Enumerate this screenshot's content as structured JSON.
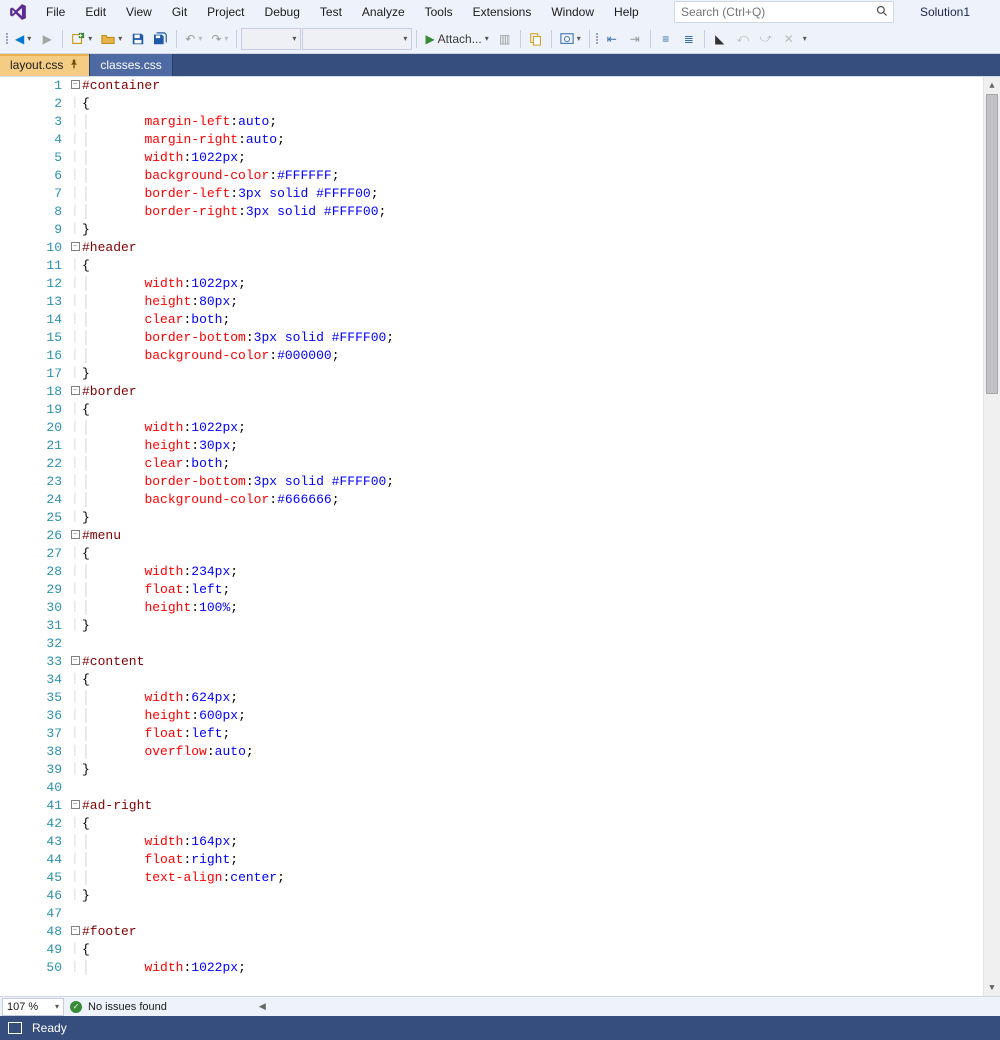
{
  "menu": {
    "items": [
      "File",
      "Edit",
      "View",
      "Git",
      "Project",
      "Debug",
      "Test",
      "Analyze",
      "Tools",
      "Extensions",
      "Window",
      "Help"
    ]
  },
  "search": {
    "placeholder": "Search (Ctrl+Q)"
  },
  "solution": {
    "label": "Solution1"
  },
  "toolbar": {
    "attach_label": "Attach..."
  },
  "tabs": [
    {
      "label": "layout.css",
      "active": true,
      "pinned": true
    },
    {
      "label": "classes.css",
      "active": false,
      "pinned": false
    }
  ],
  "editor": {
    "zoom": "107 %",
    "issues_text": "No issues found"
  },
  "statusbar": {
    "text": "Ready"
  },
  "code": {
    "lines": [
      {
        "n": 1,
        "fold": "box",
        "tokens": [
          [
            "sel",
            "#container"
          ]
        ]
      },
      {
        "n": 2,
        "fold": "pipe",
        "tokens": [
          [
            "punc",
            "{"
          ]
        ]
      },
      {
        "n": 3,
        "fold": "pipe",
        "indent": 2,
        "tokens": [
          [
            "prop",
            "margin-left"
          ],
          [
            "punc",
            ":"
          ],
          [
            "val",
            "auto"
          ],
          [
            "punc",
            ";"
          ]
        ]
      },
      {
        "n": 4,
        "fold": "pipe",
        "indent": 2,
        "tokens": [
          [
            "prop",
            "margin-right"
          ],
          [
            "punc",
            ":"
          ],
          [
            "val",
            "auto"
          ],
          [
            "punc",
            ";"
          ]
        ]
      },
      {
        "n": 5,
        "fold": "pipe",
        "indent": 2,
        "tokens": [
          [
            "prop",
            "width"
          ],
          [
            "punc",
            ":"
          ],
          [
            "val",
            "1022px"
          ],
          [
            "punc",
            ";"
          ]
        ]
      },
      {
        "n": 6,
        "fold": "pipe",
        "indent": 2,
        "tokens": [
          [
            "prop",
            "background-color"
          ],
          [
            "punc",
            ":"
          ],
          [
            "val",
            "#FFFFFF"
          ],
          [
            "punc",
            ";"
          ]
        ]
      },
      {
        "n": 7,
        "fold": "pipe",
        "indent": 2,
        "tokens": [
          [
            "prop",
            "border-left"
          ],
          [
            "punc",
            ":"
          ],
          [
            "val",
            "3px solid #FFFF00"
          ],
          [
            "punc",
            ";"
          ]
        ]
      },
      {
        "n": 8,
        "fold": "pipe",
        "indent": 2,
        "tokens": [
          [
            "prop",
            "border-right"
          ],
          [
            "punc",
            ":"
          ],
          [
            "val",
            "3px solid #FFFF00"
          ],
          [
            "punc",
            ";"
          ]
        ]
      },
      {
        "n": 9,
        "fold": "pipe",
        "tokens": [
          [
            "punc",
            "}"
          ]
        ]
      },
      {
        "n": 10,
        "fold": "box",
        "tokens": [
          [
            "sel",
            "#header"
          ]
        ]
      },
      {
        "n": 11,
        "fold": "pipe",
        "tokens": [
          [
            "punc",
            "{"
          ]
        ]
      },
      {
        "n": 12,
        "fold": "pipe",
        "indent": 2,
        "tokens": [
          [
            "prop",
            "width"
          ],
          [
            "punc",
            ":"
          ],
          [
            "val",
            "1022px"
          ],
          [
            "punc",
            ";"
          ]
        ]
      },
      {
        "n": 13,
        "fold": "pipe",
        "indent": 2,
        "tokens": [
          [
            "prop",
            "height"
          ],
          [
            "punc",
            ":"
          ],
          [
            "val",
            "80px"
          ],
          [
            "punc",
            ";"
          ]
        ]
      },
      {
        "n": 14,
        "fold": "pipe",
        "indent": 2,
        "tokens": [
          [
            "prop",
            "clear"
          ],
          [
            "punc",
            ":"
          ],
          [
            "val",
            "both"
          ],
          [
            "punc",
            ";"
          ]
        ]
      },
      {
        "n": 15,
        "fold": "pipe",
        "indent": 2,
        "tokens": [
          [
            "prop",
            "border-bottom"
          ],
          [
            "punc",
            ":"
          ],
          [
            "val",
            "3px solid #FFFF00"
          ],
          [
            "punc",
            ";"
          ]
        ]
      },
      {
        "n": 16,
        "fold": "pipe",
        "indent": 2,
        "tokens": [
          [
            "prop",
            "background-color"
          ],
          [
            "punc",
            ":"
          ],
          [
            "val",
            "#000000"
          ],
          [
            "punc",
            ";"
          ]
        ]
      },
      {
        "n": 17,
        "fold": "pipe",
        "tokens": [
          [
            "punc",
            "}"
          ]
        ]
      },
      {
        "n": 18,
        "fold": "box",
        "tokens": [
          [
            "sel",
            "#border"
          ]
        ]
      },
      {
        "n": 19,
        "fold": "pipe",
        "tokens": [
          [
            "punc",
            "{"
          ]
        ]
      },
      {
        "n": 20,
        "fold": "pipe",
        "indent": 2,
        "tokens": [
          [
            "prop",
            "width"
          ],
          [
            "punc",
            ":"
          ],
          [
            "val",
            "1022px"
          ],
          [
            "punc",
            ";"
          ]
        ]
      },
      {
        "n": 21,
        "fold": "pipe",
        "indent": 2,
        "tokens": [
          [
            "prop",
            "height"
          ],
          [
            "punc",
            ":"
          ],
          [
            "val",
            "30px"
          ],
          [
            "punc",
            ";"
          ]
        ]
      },
      {
        "n": 22,
        "fold": "pipe",
        "indent": 2,
        "tokens": [
          [
            "prop",
            "clear"
          ],
          [
            "punc",
            ":"
          ],
          [
            "val",
            "both"
          ],
          [
            "punc",
            ";"
          ]
        ]
      },
      {
        "n": 23,
        "fold": "pipe",
        "indent": 2,
        "tokens": [
          [
            "prop",
            "border-bottom"
          ],
          [
            "punc",
            ":"
          ],
          [
            "val",
            "3px solid #FFFF00"
          ],
          [
            "punc",
            ";"
          ]
        ]
      },
      {
        "n": 24,
        "fold": "pipe",
        "indent": 2,
        "tokens": [
          [
            "prop",
            "background-color"
          ],
          [
            "punc",
            ":"
          ],
          [
            "val",
            "#666666"
          ],
          [
            "punc",
            ";"
          ]
        ]
      },
      {
        "n": 25,
        "fold": "pipe",
        "tokens": [
          [
            "punc",
            "}"
          ]
        ]
      },
      {
        "n": 26,
        "fold": "box",
        "tokens": [
          [
            "sel",
            "#menu"
          ]
        ]
      },
      {
        "n": 27,
        "fold": "pipe",
        "tokens": [
          [
            "punc",
            "{"
          ]
        ]
      },
      {
        "n": 28,
        "fold": "pipe",
        "indent": 2,
        "tokens": [
          [
            "prop",
            "width"
          ],
          [
            "punc",
            ":"
          ],
          [
            "val",
            "234px"
          ],
          [
            "punc",
            ";"
          ]
        ]
      },
      {
        "n": 29,
        "fold": "pipe",
        "indent": 2,
        "tokens": [
          [
            "prop",
            "float"
          ],
          [
            "punc",
            ":"
          ],
          [
            "val",
            "left"
          ],
          [
            "punc",
            ";"
          ]
        ]
      },
      {
        "n": 30,
        "fold": "pipe",
        "indent": 2,
        "tokens": [
          [
            "prop",
            "height"
          ],
          [
            "punc",
            ":"
          ],
          [
            "val",
            "100%"
          ],
          [
            "punc",
            ";"
          ]
        ]
      },
      {
        "n": 31,
        "fold": "pipe",
        "tokens": [
          [
            "punc",
            "}"
          ]
        ]
      },
      {
        "n": 32,
        "fold": "",
        "tokens": []
      },
      {
        "n": 33,
        "fold": "box",
        "tokens": [
          [
            "sel",
            "#content"
          ]
        ]
      },
      {
        "n": 34,
        "fold": "pipe",
        "tokens": [
          [
            "punc",
            "{"
          ]
        ]
      },
      {
        "n": 35,
        "fold": "pipe",
        "indent": 2,
        "tokens": [
          [
            "prop",
            "width"
          ],
          [
            "punc",
            ":"
          ],
          [
            "val",
            "624px"
          ],
          [
            "punc",
            ";"
          ]
        ]
      },
      {
        "n": 36,
        "fold": "pipe",
        "indent": 2,
        "tokens": [
          [
            "prop",
            "height"
          ],
          [
            "punc",
            ":"
          ],
          [
            "val",
            "600px"
          ],
          [
            "punc",
            ";"
          ]
        ]
      },
      {
        "n": 37,
        "fold": "pipe",
        "indent": 2,
        "tokens": [
          [
            "prop",
            "float"
          ],
          [
            "punc",
            ":"
          ],
          [
            "val",
            "left"
          ],
          [
            "punc",
            ";"
          ]
        ]
      },
      {
        "n": 38,
        "fold": "pipe",
        "indent": 2,
        "tokens": [
          [
            "prop",
            "overflow"
          ],
          [
            "punc",
            ":"
          ],
          [
            "val",
            "auto"
          ],
          [
            "punc",
            ";"
          ]
        ]
      },
      {
        "n": 39,
        "fold": "pipe",
        "tokens": [
          [
            "punc",
            "}"
          ]
        ]
      },
      {
        "n": 40,
        "fold": "",
        "tokens": []
      },
      {
        "n": 41,
        "fold": "box",
        "tokens": [
          [
            "sel",
            "#ad-right"
          ]
        ]
      },
      {
        "n": 42,
        "fold": "pipe",
        "tokens": [
          [
            "punc",
            "{"
          ]
        ]
      },
      {
        "n": 43,
        "fold": "pipe",
        "indent": 2,
        "tokens": [
          [
            "prop",
            "width"
          ],
          [
            "punc",
            ":"
          ],
          [
            "val",
            "164px"
          ],
          [
            "punc",
            ";"
          ]
        ]
      },
      {
        "n": 44,
        "fold": "pipe",
        "indent": 2,
        "tokens": [
          [
            "prop",
            "float"
          ],
          [
            "punc",
            ":"
          ],
          [
            "val",
            "right"
          ],
          [
            "punc",
            ";"
          ]
        ]
      },
      {
        "n": 45,
        "fold": "pipe",
        "indent": 2,
        "tokens": [
          [
            "prop",
            "text-align"
          ],
          [
            "punc",
            ":"
          ],
          [
            "val",
            "center"
          ],
          [
            "punc",
            ";"
          ]
        ]
      },
      {
        "n": 46,
        "fold": "pipe",
        "tokens": [
          [
            "punc",
            "}"
          ]
        ]
      },
      {
        "n": 47,
        "fold": "",
        "tokens": []
      },
      {
        "n": 48,
        "fold": "box",
        "tokens": [
          [
            "sel",
            "#footer"
          ]
        ]
      },
      {
        "n": 49,
        "fold": "pipe",
        "tokens": [
          [
            "punc",
            "{"
          ]
        ]
      },
      {
        "n": 50,
        "fold": "pipe",
        "indent": 2,
        "tokens": [
          [
            "prop",
            "width"
          ],
          [
            "punc",
            ":"
          ],
          [
            "val",
            "1022px"
          ],
          [
            "punc",
            ";"
          ]
        ]
      }
    ]
  }
}
